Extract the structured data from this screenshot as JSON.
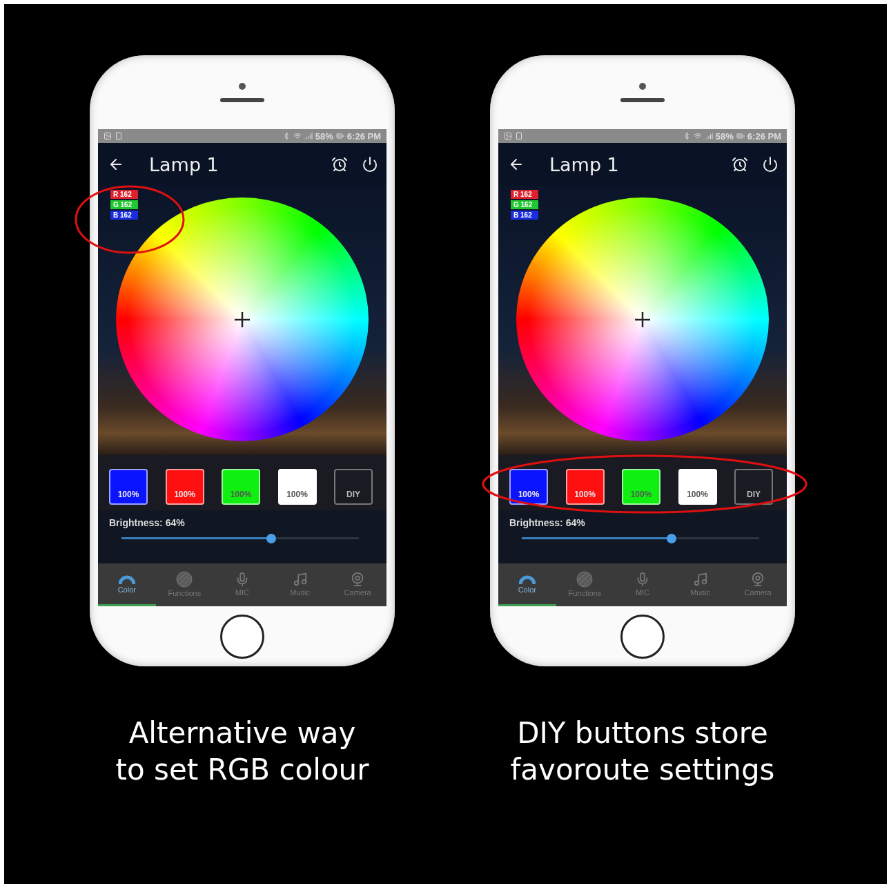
{
  "panels": [
    {
      "phone": {
        "rgb_highlighted": true,
        "status_bar": {
          "battery": "58%",
          "time": "6:26 PM"
        },
        "title": "Lamp 1",
        "rgb": [
          {
            "channel": "R",
            "value": "162",
            "color": "#e0202a"
          },
          {
            "channel": "G",
            "value": "162",
            "color": "#22c832"
          },
          {
            "channel": "B",
            "value": "162",
            "color": "#1a2ee0"
          }
        ],
        "presets": [
          {
            "kind": "color",
            "label": "100%",
            "color": "#0a14ff"
          },
          {
            "kind": "color",
            "label": "100%",
            "color": "#ff1010"
          },
          {
            "kind": "color",
            "label": "100%",
            "color": "#10f010"
          },
          {
            "kind": "color",
            "label": "100%",
            "color": "#ffffff"
          },
          {
            "kind": "diy",
            "label": "DIY"
          }
        ],
        "brightness": {
          "label": "Brightness: 64%",
          "level": 0.63
        },
        "tabs": [
          {
            "label": "Color",
            "selected": true
          },
          {
            "label": "Functions",
            "selected": false
          },
          {
            "label": "MIC",
            "selected": false
          },
          {
            "label": "Music",
            "selected": false
          },
          {
            "label": "Camera",
            "selected": false
          }
        ]
      },
      "caption": [
        "Alternative way",
        "to set RGB colour"
      ]
    },
    {
      "phone": {
        "presets_highlighted": true,
        "status_bar": {
          "battery": "58%",
          "time": "6:26 PM"
        },
        "title": "Lamp 1",
        "rgb": [
          {
            "channel": "R",
            "value": "162",
            "color": "#e0202a"
          },
          {
            "channel": "G",
            "value": "162",
            "color": "#22c832"
          },
          {
            "channel": "B",
            "value": "162",
            "color": "#1a2ee0"
          }
        ],
        "presets": [
          {
            "kind": "color",
            "label": "100%",
            "color": "#0a14ff"
          },
          {
            "kind": "color",
            "label": "100%",
            "color": "#ff1010"
          },
          {
            "kind": "color",
            "label": "100%",
            "color": "#10f010"
          },
          {
            "kind": "color",
            "label": "100%",
            "color": "#ffffff"
          },
          {
            "kind": "diy",
            "label": "DIY"
          }
        ],
        "brightness": {
          "label": "Brightness: 64%",
          "level": 0.63
        },
        "tabs": [
          {
            "label": "Color",
            "selected": true
          },
          {
            "label": "Functions",
            "selected": false
          },
          {
            "label": "MIC",
            "selected": false
          },
          {
            "label": "Music",
            "selected": false
          },
          {
            "label": "Camera",
            "selected": false
          }
        ]
      },
      "caption": [
        "DIY buttons store",
        "favoroute settings"
      ]
    }
  ]
}
